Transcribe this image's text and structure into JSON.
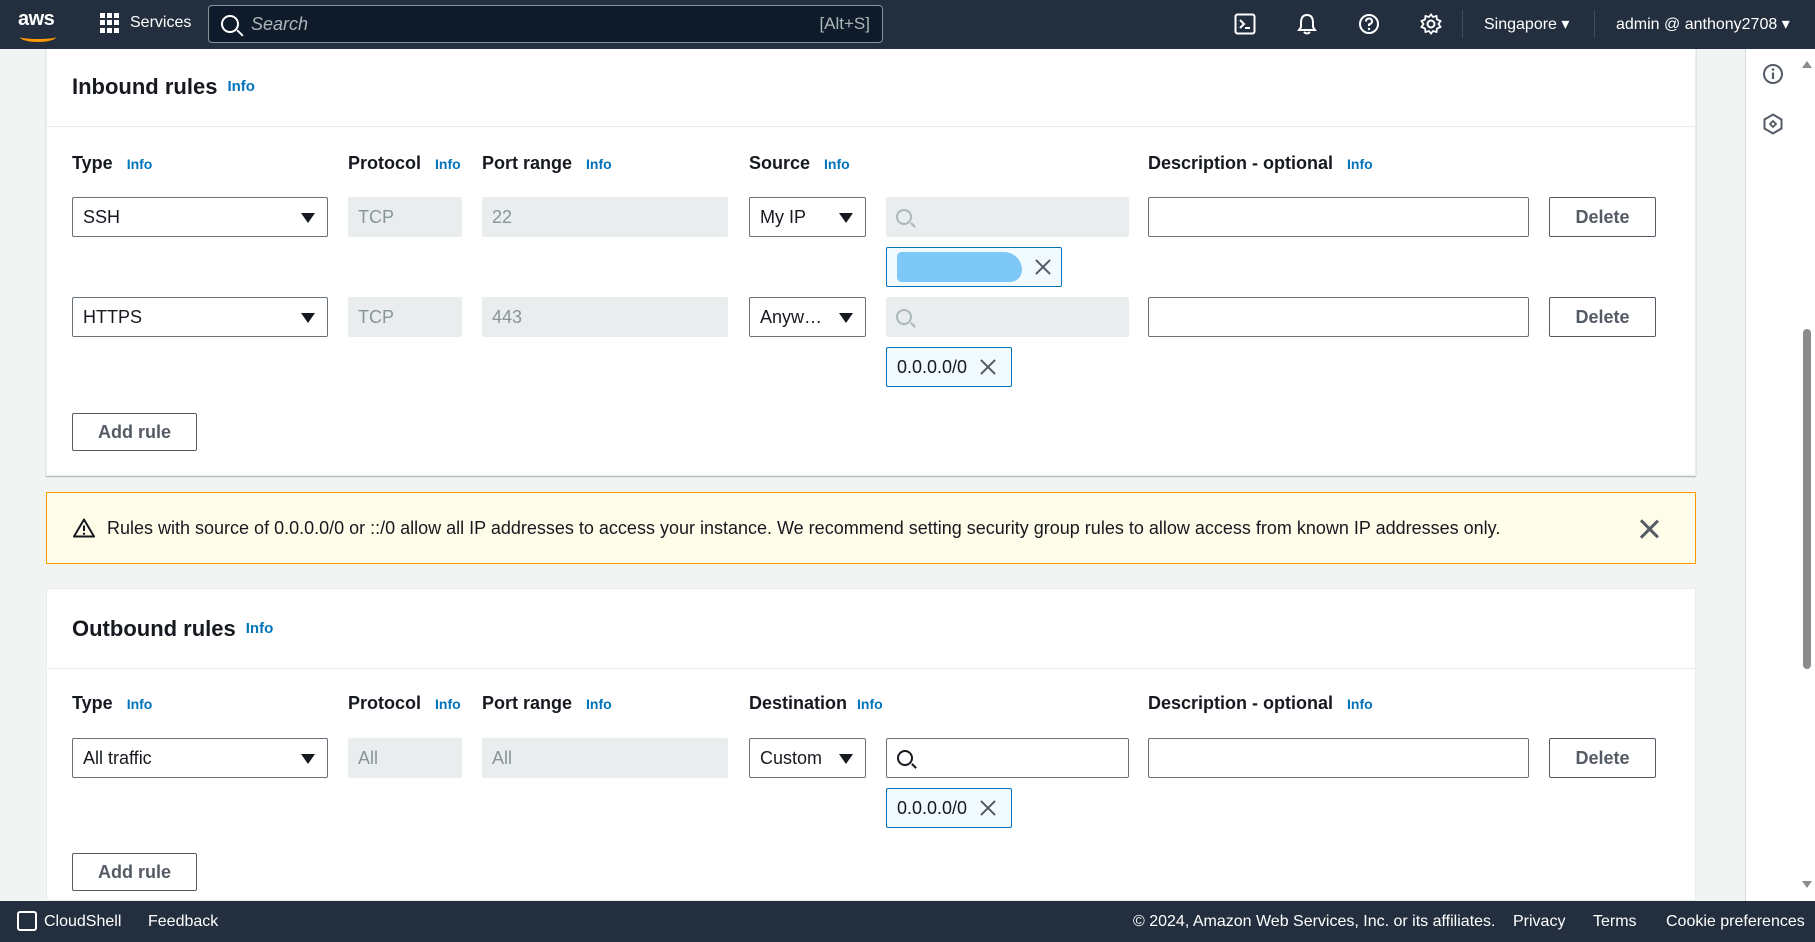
{
  "nav": {
    "logo": "aws",
    "services": "Services",
    "search_placeholder": "Search",
    "search_shortcut": "[Alt+S]",
    "icons": [
      "cloudshell-icon",
      "bell-icon",
      "help-icon",
      "gear-icon"
    ],
    "region": "Singapore ▾",
    "user": "admin @ anthony2708 ▾"
  },
  "inbound": {
    "title": "Inbound rules",
    "info": "Info",
    "columns": {
      "type": "Type",
      "protocol": "Protocol",
      "port_range": "Port range",
      "source": "Source",
      "description": "Description - optional",
      "info": "Info"
    },
    "rules": [
      {
        "type": "SSH",
        "protocol": "TCP",
        "port": "22",
        "source": "My IP",
        "token": "",
        "token_redacted": true,
        "delete": "Delete"
      },
      {
        "type": "HTTPS",
        "protocol": "TCP",
        "port": "443",
        "source": "Anyw…",
        "token": "0.0.0.0/0",
        "delete": "Delete"
      }
    ],
    "add_rule": "Add rule"
  },
  "alert": {
    "message": "Rules with source of 0.0.0.0/0 or ::/0 allow all IP addresses to access your instance. We recommend setting security group rules to allow access from known IP addresses only.",
    "color": "#ff9900"
  },
  "outbound": {
    "title": "Outbound rules",
    "info": "Info",
    "columns": {
      "type": "Type",
      "protocol": "Protocol",
      "port_range": "Port range",
      "destination": "Destination",
      "description": "Description - optional",
      "info": "Info"
    },
    "rules": [
      {
        "type": "All traffic",
        "protocol": "All",
        "port": "All",
        "destination": "Custom",
        "token": "0.0.0.0/0",
        "delete": "Delete"
      }
    ],
    "add_rule": "Add rule"
  },
  "footer": {
    "cloudshell": "CloudShell",
    "feedback": "Feedback",
    "copyright": "© 2024, Amazon Web Services, Inc. or its affiliates.",
    "privacy": "Privacy",
    "terms": "Terms",
    "cookies": "Cookie preferences"
  },
  "colors": {
    "nav_bg": "#232f3e",
    "link": "#0073bb",
    "warning": "#ff9900"
  }
}
